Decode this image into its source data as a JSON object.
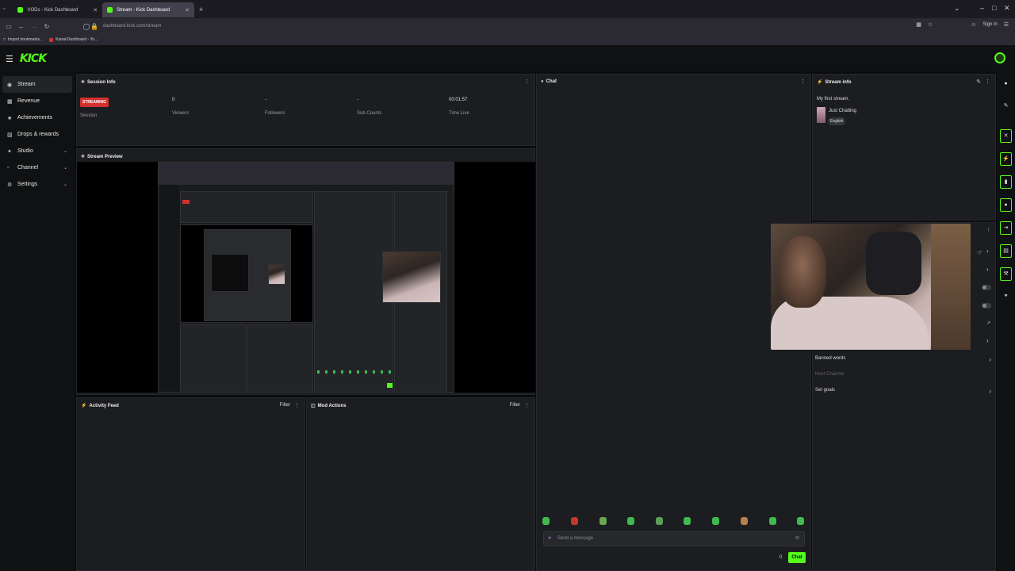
{
  "browser": {
    "tabs": [
      {
        "label": "VODs - Kick Dashboard",
        "active": false
      },
      {
        "label": "Stream - Kick Dashboard",
        "active": true
      }
    ],
    "new_tab": "+",
    "url": "dashboard.kick.com/stream",
    "sign_in": "Sign in",
    "bookmarks": [
      "Import bookmarks...",
      "Kanal-Dashboard - Yo..."
    ]
  },
  "app": {
    "logo": "KICK"
  },
  "sidebar": {
    "items": [
      {
        "label": "Stream",
        "icon": "broadcast-icon"
      },
      {
        "label": "Revenue",
        "icon": "dollar-icon"
      },
      {
        "label": "Achievements",
        "icon": "trophy-icon"
      },
      {
        "label": "Drops & rewards",
        "icon": "gift-icon"
      },
      {
        "label": "Studio",
        "icon": "studio-icon"
      },
      {
        "label": "Channel",
        "icon": "channel-icon"
      },
      {
        "label": "Settings",
        "icon": "gear-icon"
      }
    ]
  },
  "session": {
    "title": "Session Info",
    "badge": "STREAMING",
    "badge_label": "Session",
    "viewers": "0",
    "viewers_label": "Viewers",
    "followers": "-",
    "followers_label": "Followers",
    "subs": "-",
    "subs_label": "Sub Counts",
    "time_live": "00:01:57",
    "time_label": "Time Live"
  },
  "preview": {
    "title": "Stream Preview"
  },
  "activity": {
    "title": "Activity Feed",
    "filter": "Filter"
  },
  "mod": {
    "title": "Mod Actions",
    "filter": "Filter"
  },
  "chat": {
    "title": "Chat",
    "placeholder": "Send a message",
    "count": "0",
    "send": "Chat"
  },
  "stream_info": {
    "title": "Stream info",
    "stream_title": "My first stream.",
    "category": "Just Chatting",
    "language": "English",
    "rows": {
      "banned_words": "Banned words",
      "host_channel": "Host Channel",
      "set_goals": "Set goals"
    }
  },
  "colors": {
    "accent": "#53fc18",
    "live": "#d32f2f"
  }
}
